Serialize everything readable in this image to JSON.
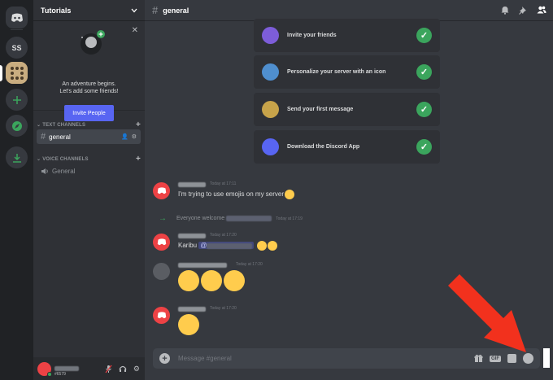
{
  "servers": {
    "ss_label": "SS"
  },
  "sidebar": {
    "guild_name": "Tutorials",
    "invite": {
      "line1": "An adventure begins.",
      "line2": "Let's add some friends!",
      "button": "Invite People"
    },
    "text_category": "TEXT CHANNELS",
    "voice_category": "VOICE CHANNELS",
    "text_channels": [
      {
        "name": "general"
      }
    ],
    "voice_channels": [
      {
        "name": "General"
      }
    ],
    "user": {
      "tag": "#6579"
    }
  },
  "main": {
    "channel_title": "general",
    "checklist": [
      {
        "label": "Invite your friends"
      },
      {
        "label": "Personalize your server with an icon"
      },
      {
        "label": "Send your first message"
      },
      {
        "label": "Download the Discord App"
      }
    ],
    "messages": [
      {
        "timestamp": "Today at 17:11",
        "text": "I'm trying to use emojis on my server"
      },
      {
        "timestamp": "Today at 17:19",
        "text": "Everyone welcome"
      },
      {
        "timestamp": "Today at 17:20",
        "text": "Karibu",
        "mention": "@"
      },
      {
        "timestamp": "Today at 17:20"
      },
      {
        "timestamp": "Today at 17:20"
      }
    ],
    "composer_placeholder": "Message #general",
    "gif_label": "GIF"
  },
  "colors": {
    "accent": "#5865f2",
    "online": "#3ba55d",
    "danger": "#ed4245",
    "annotation_arrow": "#f2311d"
  }
}
